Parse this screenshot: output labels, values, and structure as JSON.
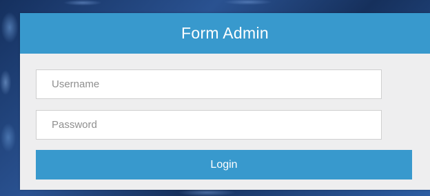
{
  "form": {
    "title": "Form Admin",
    "username_placeholder": "Username",
    "password_placeholder": "Password",
    "login_label": "Login"
  },
  "colors": {
    "accent": "#3899cd",
    "card_background": "#eeeeef",
    "page_background": "#1b3768"
  }
}
